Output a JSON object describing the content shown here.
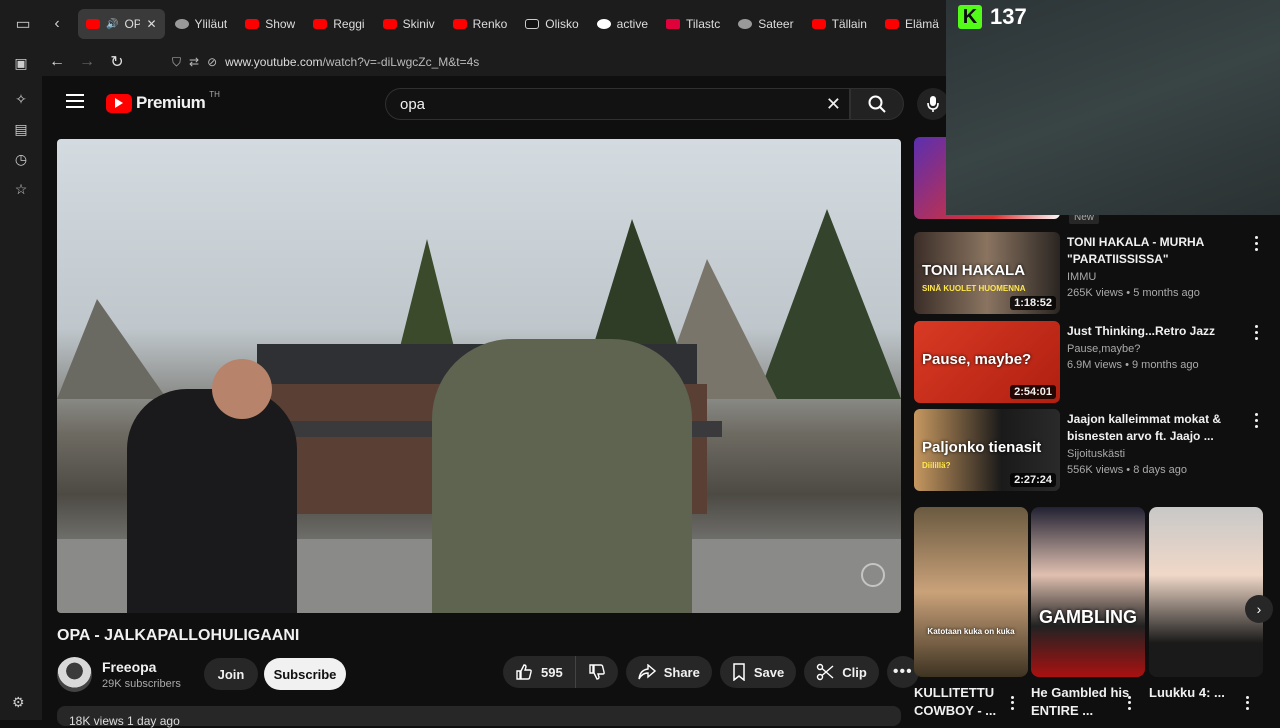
{
  "tabs": [
    {
      "label": "OPA",
      "icon": "youtube-icon",
      "active": true
    },
    {
      "label": "Yliläut",
      "icon": "bird-icon"
    },
    {
      "label": "Show",
      "icon": "youtube-icon"
    },
    {
      "label": "Reggi",
      "icon": "youtube-icon"
    },
    {
      "label": "Skiniv",
      "icon": "youtube-icon"
    },
    {
      "label": "Renko",
      "icon": "youtube-icon"
    },
    {
      "label": "Olisko",
      "icon": "tiktok-icon"
    },
    {
      "label": "active",
      "icon": "google-icon"
    },
    {
      "label": "Tilastc",
      "icon": "iltalehti-icon"
    },
    {
      "label": "Sateer",
      "icon": "bird-icon"
    },
    {
      "label": "Tällain",
      "icon": "youtube-icon"
    },
    {
      "label": "Elämä",
      "icon": "youtube-icon"
    }
  ],
  "address_bar": {
    "url_host": "www.youtube.com",
    "url_path": "/watch?v=-diLwgcZc_M&t=4s"
  },
  "youtube": {
    "logo_text": "Premium",
    "logo_country": "TH",
    "search_value": "opa"
  },
  "video": {
    "title": "OPA - JALKAPALLOHULIGAANI",
    "channel": "Freeopa",
    "subscribers": "29K subscribers",
    "join_label": "Join",
    "subscribe_label": "Subscribe",
    "likes": "595",
    "share_label": "Share",
    "save_label": "Save",
    "clip_label": "Clip",
    "description_peek": "18K views  1 day ago"
  },
  "recommendations": {
    "top_badge": "New",
    "items": [
      {
        "title": "TONI HAKALA -  MURHA \"PARATIISSISSA\"",
        "channel": "IMMU",
        "meta": "265K views • 5 months ago",
        "duration": "1:18:52",
        "thumb_text": "TONI HAKALA",
        "thumb_subtext": "SINÄ KUOLET HUOMENNA"
      },
      {
        "title": "Just Thinking...Retro Jazz",
        "channel": "Pause,maybe?",
        "meta": "6.9M views • 9 months ago",
        "duration": "2:54:01",
        "thumb_text": "Pause, maybe?"
      },
      {
        "title": "Jaajon kalleimmat mokat & bisnesten arvo ft. Jaajo ...",
        "channel": "Sijoituskästi",
        "meta": "556K views • 8 days ago",
        "duration": "2:27:24",
        "thumb_text": "Paljonko tienasit",
        "thumb_subtext": "Diilillä?"
      }
    ]
  },
  "shorts": [
    {
      "title": "KULLITETTU COWBOY - ...",
      "thumb_text": "Katotaan kuka on kuka"
    },
    {
      "title": "He Gambled his ENTIRE ...",
      "thumb_text": "GAMBLING"
    },
    {
      "title": "Luukku 4: ...",
      "thumb_text": ""
    }
  ],
  "overlay": {
    "logo_letter": "K",
    "count": "137"
  },
  "colors": {
    "background": "#0f0f0f",
    "accent_red": "#ff0000",
    "kick_green": "#53fc18"
  }
}
